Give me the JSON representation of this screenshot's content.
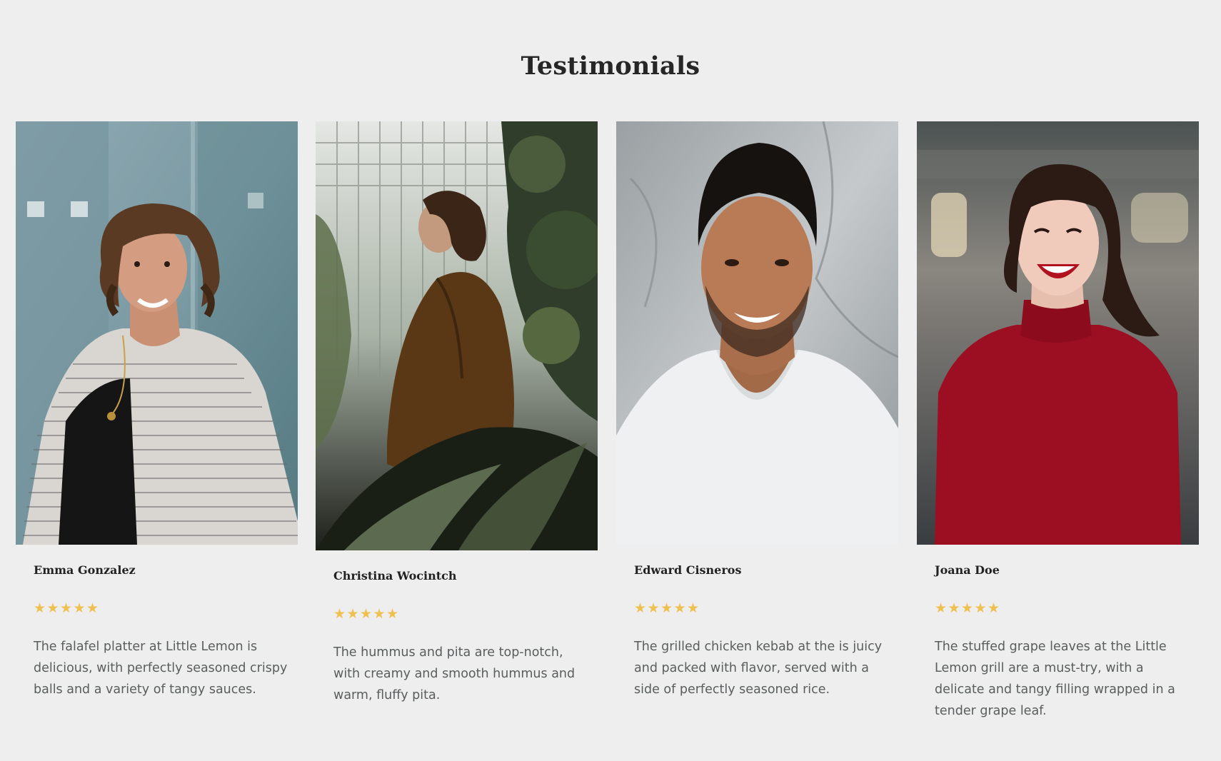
{
  "section": {
    "title": "Testimonials"
  },
  "testimonials": [
    {
      "name": "Emma Gonzalez",
      "stars": [
        "★",
        "★",
        "★",
        "★",
        "★"
      ],
      "text": "The falafel platter at Little Lemon is delicious, with perfectly seasoned crispy balls and a variety of tangy sauces."
    },
    {
      "name": "Christina Wocintch",
      "stars": [
        "★",
        "★",
        "★",
        "★",
        "★"
      ],
      "text": "The hummus and pita are top-notch, with creamy and smooth hummus and warm, fluffy pita."
    },
    {
      "name": "Edward Cisneros",
      "stars": [
        "★",
        "★",
        "★",
        "★",
        "★"
      ],
      "text": "The grilled chicken kebab at the is juicy and packed with flavor, served with a side of perfectly seasoned rice."
    },
    {
      "name": "Joana Doe",
      "stars": [
        "★",
        "★",
        "★",
        "★",
        "★"
      ],
      "text": "The stuffed grape leaves at the Little Lemon grill are a must-try, with a delicate and tangy filling wrapped in a tender grape leaf."
    }
  ],
  "colors": {
    "background": "#edeeed",
    "star": "#eec050",
    "heading": "#262626",
    "body_text": "#5a5d5e"
  }
}
